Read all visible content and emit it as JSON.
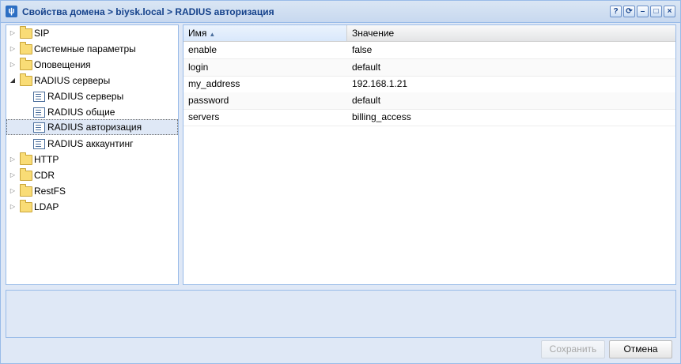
{
  "window": {
    "title": "Свойства домена > biysk.local > RADIUS авторизация",
    "app_icon": "app-logo-icon",
    "tools": [
      {
        "name": "help-icon",
        "glyph": "?"
      },
      {
        "name": "refresh-icon",
        "glyph": "⟳"
      },
      {
        "name": "minimize-icon",
        "glyph": "–"
      },
      {
        "name": "maximize-icon",
        "glyph": "□"
      },
      {
        "name": "close-icon",
        "glyph": "×"
      }
    ]
  },
  "tree": {
    "items": [
      {
        "label": "SIP",
        "type": "folder",
        "expanded": false
      },
      {
        "label": "Системные параметры",
        "type": "folder",
        "expanded": false
      },
      {
        "label": "Оповещения",
        "type": "folder",
        "expanded": false
      },
      {
        "label": "RADIUS серверы",
        "type": "folder",
        "expanded": true
      },
      {
        "label": "RADIUS серверы",
        "type": "leaf"
      },
      {
        "label": "RADIUS общие",
        "type": "leaf"
      },
      {
        "label": "RADIUS авторизация",
        "type": "leaf",
        "selected": true
      },
      {
        "label": "RADIUS аккаунтинг",
        "type": "leaf"
      },
      {
        "label": "HTTP",
        "type": "folder",
        "expanded": false
      },
      {
        "label": "CDR",
        "type": "folder",
        "expanded": false
      },
      {
        "label": "RestFS",
        "type": "folder",
        "expanded": false
      },
      {
        "label": "LDAP",
        "type": "folder",
        "expanded": false
      }
    ]
  },
  "grid": {
    "columns": {
      "name": "Имя",
      "value": "Значение"
    },
    "rows": [
      {
        "name": "enable",
        "value": "false"
      },
      {
        "name": "login",
        "value": "default"
      },
      {
        "name": "my_address",
        "value": "192.168.1.21"
      },
      {
        "name": "password",
        "value": "default"
      },
      {
        "name": "servers",
        "value": "billing_access"
      }
    ]
  },
  "buttons": {
    "save": "Сохранить",
    "cancel": "Отмена"
  },
  "colors": {
    "title_text": "#15428b",
    "panel_border": "#99bbe8",
    "window_bg": "#dfe8f6",
    "folder": "#f9dc76"
  }
}
